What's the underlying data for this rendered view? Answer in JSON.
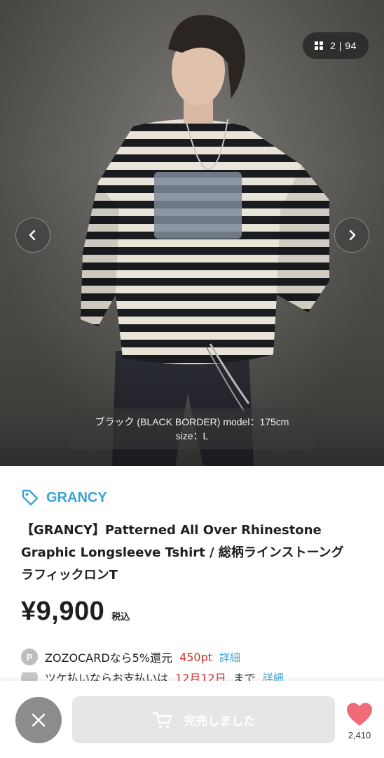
{
  "gallery": {
    "counter": "2 | 94",
    "caption_line1": "ブラック (BLACK BORDER) model：175cm",
    "caption_line2": "size：L"
  },
  "product": {
    "brand": "GRANCY",
    "title_line1": "【GRANCY】Patterned All Over Rhinestone",
    "title_line2": "Graphic Longsleeve Tshirt / 総柄ラインストーング",
    "title_line3": "ラフィックロンT",
    "price": "¥9,900",
    "tax_label": "税込"
  },
  "points": {
    "badge": "P",
    "text": "ZOZOCARDなら5%還元",
    "amount": "450pt",
    "detail_link": "詳細"
  },
  "peek_row": {
    "text": "ツケ払いならお支払いは",
    "date": "12月12日",
    "suffix": "まで",
    "link": "詳細"
  },
  "bottom_bar": {
    "sold_out_label": "完売しました",
    "favorite_count": "2,410"
  },
  "colors": {
    "accent": "#3aa3d6",
    "price_red": "#d0312d",
    "favorite": "#f06a78"
  },
  "icons": [
    "grid-icon",
    "chevron-left-icon",
    "chevron-right-icon",
    "tag-icon",
    "close-icon",
    "cart-icon",
    "heart-icon"
  ]
}
